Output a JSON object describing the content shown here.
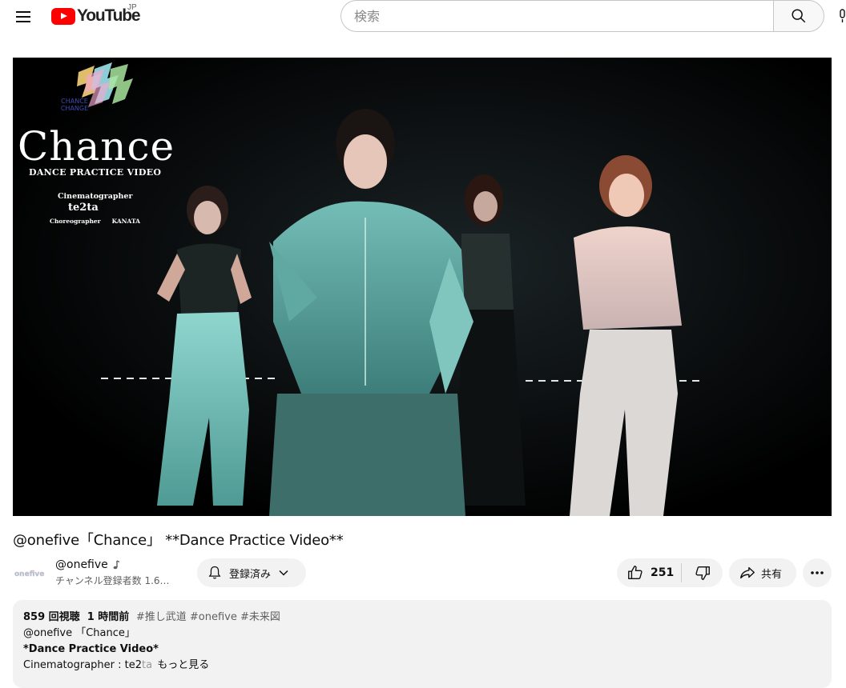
{
  "masthead": {
    "logo_text": "YouTube",
    "region": "JP",
    "search_placeholder": "検索"
  },
  "video_overlay": {
    "title": "Chance",
    "subtitle": "DANCE PRACTICE VIDEO",
    "cinematographer_label": "Cinematographer",
    "cinematographer_name": "te2ta",
    "choreographer_label": "Choreographer",
    "choreographer_name": "KANATA",
    "logo_text_line1": "CHANCE",
    "logo_text_line2": "CHANGE"
  },
  "video": {
    "title": "@onefive「Chance」 **Dance Practice Video**"
  },
  "channel": {
    "name": "@onefive",
    "subscribers": "チャンネル登録者数 1.6…",
    "avatar_text": "onefive"
  },
  "subscribe": {
    "label": "登録済み"
  },
  "actions": {
    "like_count": "251",
    "share_label": "共有"
  },
  "description": {
    "views": "859 回視聴",
    "time": "1 時間前",
    "tags": "#推し武道 #onefive #未来図",
    "line1": "@onefive 「Chance」",
    "line2": " *Dance Practice Video*",
    "line3_prefix": "Cinematographer : te2",
    "line3_fade": "ta",
    "more": "もっと見る"
  },
  "colors": {
    "brand_red": "#ff0000",
    "chip_bg": "#f2f2f2",
    "video_bg": "#000000"
  }
}
